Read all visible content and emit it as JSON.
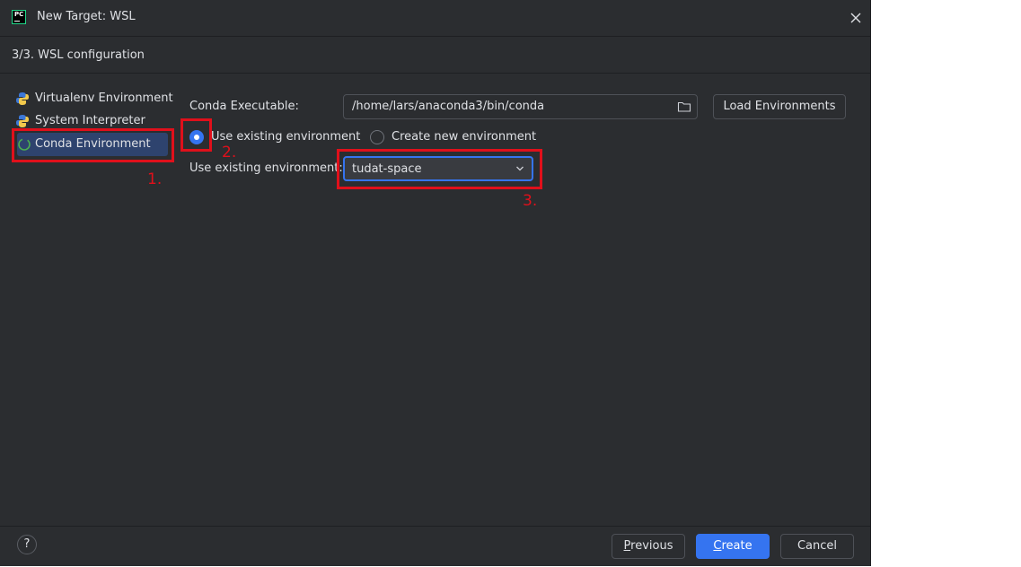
{
  "window": {
    "title": "New Target: WSL"
  },
  "step": {
    "title": "3/3. WSL configuration"
  },
  "sidebar": {
    "items": [
      {
        "label": "Virtualenv Environment",
        "icon": "python-icon"
      },
      {
        "label": "System Interpreter",
        "icon": "python-icon"
      },
      {
        "label": "Conda Environment",
        "icon": "conda-icon",
        "selected": true
      }
    ]
  },
  "form": {
    "conda_executable_label": "Conda Executable:",
    "conda_executable_value": "/home/lars/anaconda3/bin/conda",
    "load_environments_label": "Load Environments",
    "radio_use_existing_label": "Use existing environment",
    "radio_create_new_label": "Create new environment",
    "selected_radio": "use_existing",
    "existing_env_label": "Use existing environment:",
    "existing_env_value": "tudat-space"
  },
  "annotations": [
    {
      "label": "1."
    },
    {
      "label": "2."
    },
    {
      "label": "3."
    }
  ],
  "annotation_color": "#e0101b",
  "footer": {
    "help_label": "?",
    "previous_label_mnemonic": "P",
    "previous_label_rest": "revious",
    "create_label_mnemonic": "C",
    "create_label_rest": "reate",
    "cancel_label": "Cancel"
  },
  "colors": {
    "background": "#2b2d30",
    "accent": "#3574f0",
    "selection": "#2e436e",
    "text": "#dfe1e5"
  }
}
